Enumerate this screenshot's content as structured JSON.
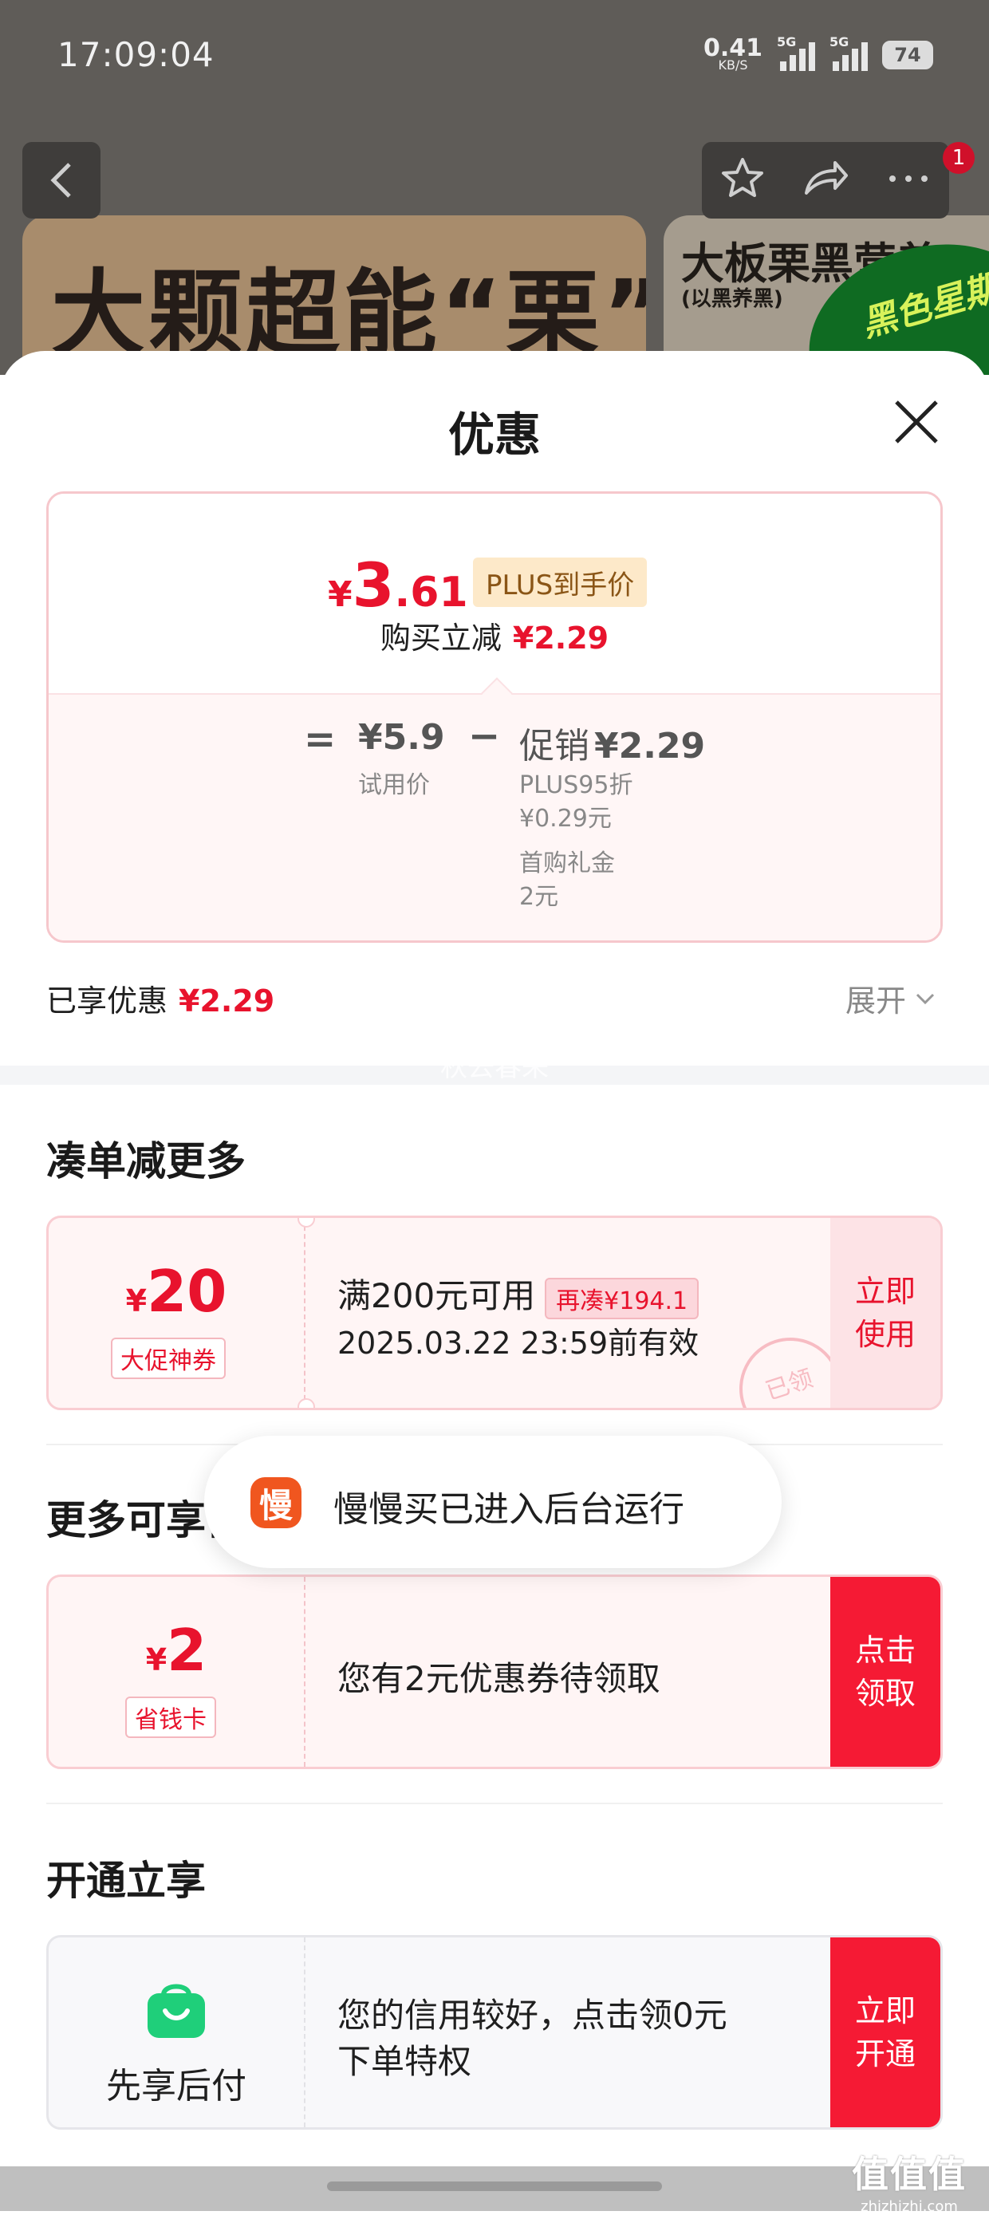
{
  "status_bar": {
    "time": "17:09:04",
    "net_speed": "0.41",
    "net_unit": "KB/S",
    "signal_tag_1": "5G",
    "signal_tag_2": "5G",
    "battery": "74"
  },
  "background_page": {
    "banner_main": "大颗超能“栗”",
    "banner_side_title": "大板栗黑营养",
    "banner_side_sub": "(以黑养黑)",
    "banner_side_badge": "黑色星期五",
    "notification_count": "1"
  },
  "sheet": {
    "title": "优惠",
    "price_summary": {
      "currency": "¥",
      "final_int": "3",
      "final_dec": ".61",
      "plus_tag": "PLUS到手价",
      "instant_cut_label": "购买立减",
      "instant_cut_value": "¥2.29",
      "equals": "=",
      "trial_price": "¥5.9",
      "trial_label": "试用价",
      "minus": "−",
      "promo_label": "促销",
      "promo_value": "¥2.29",
      "promo_items": [
        "PLUS95折",
        "¥0.29元",
        "首购礼金",
        "2元"
      ]
    },
    "enjoyed_label": "已享优惠",
    "enjoyed_value": "¥2.29",
    "expand_label": "展开",
    "watermark": "秋去春来"
  },
  "sections": {
    "combine": {
      "title": "凑单减更多",
      "coupon": {
        "currency": "¥",
        "amount": "20",
        "tag": "大促神券",
        "condition": "满200元可用",
        "gap_tag": "再凑¥194.1",
        "expiry": "2025.03.22 23:59前有效",
        "action": "立即\n使用",
        "stamp": "已领"
      }
    },
    "more": {
      "title": "更多可享优惠",
      "coupon": {
        "currency": "¥",
        "amount": "2",
        "tag": "省钱卡",
        "desc": "您有2元优惠券待领取",
        "action": "点击\n领取"
      }
    },
    "activate": {
      "title": "开通立享",
      "card": {
        "label": "先享后付",
        "desc_line1": "您的信用较好，点击领0元",
        "desc_line2": "下单特权",
        "action": "立即\n开通"
      }
    }
  },
  "toast": {
    "icon_char": "慢",
    "text": "慢慢买已进入后台运行"
  },
  "brand_watermark": {
    "big": "值值值",
    "small": "zhizhizhi.com"
  },
  "colors": {
    "accent_red": "#e8132d",
    "action_red": "#f51a34",
    "plus_gold_bg": "#fde9c9",
    "bnpl_green": "#1fcf7a",
    "toast_icon": "#f0561f"
  }
}
